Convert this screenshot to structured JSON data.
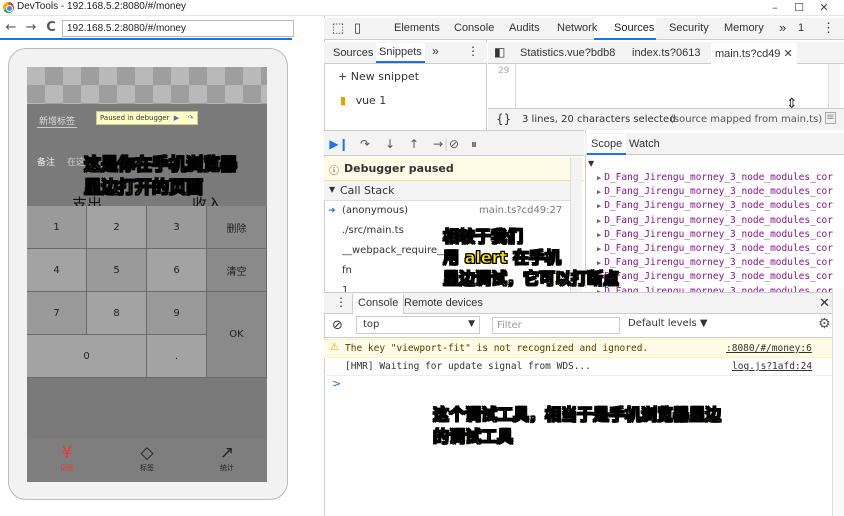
{
  "window": {
    "title": "DevTools - 192.168.5.2:8080/#/money",
    "controls": [
      "–",
      "☐",
      "✕"
    ]
  },
  "browser": {
    "url": "192.168.5.2:8080/#/money",
    "back": "←",
    "forward": "→",
    "reload": "C"
  },
  "app": {
    "tag_button": "新增标签",
    "paused_label": "Paused in debugger",
    "remark_label": "备注",
    "remark_placeholder": "在这",
    "tabs": [
      "支出",
      "收入"
    ],
    "amount": "0",
    "keys": [
      "1",
      "2",
      "3",
      "删除",
      "4",
      "5",
      "6",
      "清空",
      "7",
      "8",
      "9",
      "OK",
      "0",
      "."
    ],
    "nav": [
      {
        "icon": "¥",
        "label": "记账"
      },
      {
        "icon": "◇",
        "label": "标签"
      },
      {
        "icon": "↗",
        "label": "统计"
      }
    ],
    "colors": {
      "accent": "#e53935"
    }
  },
  "devtools": {
    "tabs": [
      "Elements",
      "Console",
      "Audits",
      "Network",
      "Sources",
      "Security",
      "Memory"
    ],
    "more_tabs": "»",
    "count_badge": "1",
    "nav_tabs": [
      "Sources",
      "Snippets"
    ],
    "new_snippet": "New snippet",
    "snippet": "vue 1",
    "editor_tabs": [
      "Statistics.vue?bdb8",
      "index.ts?0613",
      "main.ts?cd49"
    ],
    "line_number": "29",
    "status": "3 lines, 20 characters selected",
    "status_map": "(source mapped from main.ts)",
    "paused": "Debugger paused",
    "callstack_title": "Call Stack",
    "frames": [
      {
        "name": "(anonymous)",
        "loc": "main.ts?cd49:27"
      },
      {
        "name": "./src/main.ts",
        "loc": ""
      },
      {
        "name": "__webpack_require__",
        "loc": ""
      },
      {
        "name": "fn",
        "loc": ""
      },
      {
        "name": "1",
        "loc": ""
      }
    ],
    "scope_tabs": [
      "Scope",
      "Watch"
    ],
    "scope_rows": [
      "D_Fang_Jirengu_morney_3_node_modules_cor",
      "D_Fang_Jirengu_morney_3_node_modules_cor",
      "D_Fang_Jirengu_morney_3_node_modules_cor",
      "D_Fang_Jirengu_morney_3_node_modules_cor",
      "D_Fang_Jirengu_morney_3_node_modules_cor",
      "D_Fang_Jirengu_morney_3_node_modules_cor",
      "D_Fang_Jirengu_morney_3_node_modules_cor",
      "D_Fang_Jirengu_morney_3_node_modules_cor",
      "D_Fang_Jirengu_morney_3_node_modules_cor"
    ],
    "console_tabs": [
      "Console",
      "Remote devices"
    ],
    "context": "top",
    "filter_placeholder": "Filter",
    "levels": "Default levels ▼",
    "logs": [
      {
        "text": "The key \"viewport-fit\" is not recognized and ignored.",
        "src": ":8080/#/money:6",
        "level": "warn"
      },
      {
        "text": "[HMR] Waiting for update signal from WDS...",
        "src": "log.js?1afd:24",
        "level": "info"
      }
    ],
    "prompt": ">"
  },
  "annotations": {
    "a1": [
      "这是你在手机浏览器",
      "里边打开的页面"
    ],
    "a2": [
      "相较于我们",
      "用 alert 在手机",
      "里边调试，它可以打断点"
    ],
    "a3": [
      "这个调试工具，相当于是手机浏览器里边",
      "的调试工具"
    ]
  }
}
